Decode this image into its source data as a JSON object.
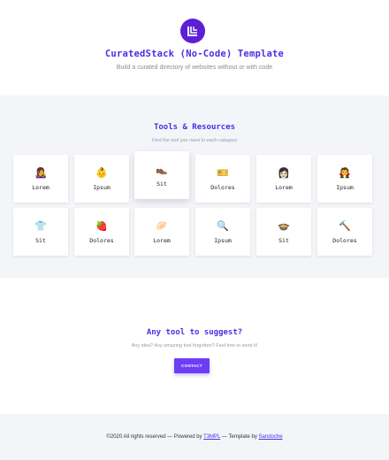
{
  "hero": {
    "title": "CuratedStack (No-Code) Template",
    "subtitle": "Build a curated directory of websites without or with code"
  },
  "tools": {
    "title": "Tools & Resources",
    "subtitle": "Find the tool you need in each category",
    "cards": [
      {
        "emoji": "👩‍🎤",
        "label": "Lorem"
      },
      {
        "emoji": "👶",
        "label": "Ipsum"
      },
      {
        "emoji": "👞",
        "label": "Sit"
      },
      {
        "emoji": "🎫",
        "label": "Dolores"
      },
      {
        "emoji": "👩🏻",
        "label": "Lorem"
      },
      {
        "emoji": "🧛",
        "label": "Ipsum"
      },
      {
        "emoji": "👕",
        "label": "Sit"
      },
      {
        "emoji": "🍓",
        "label": "Dolores"
      },
      {
        "emoji": "🥟",
        "label": "Lorem"
      },
      {
        "emoji": "🔍",
        "label": "Ipsum"
      },
      {
        "emoji": "🍲",
        "label": "Sit"
      },
      {
        "emoji": "🔨",
        "label": "Dolores"
      }
    ]
  },
  "suggest": {
    "title": "Any tool to suggest?",
    "subtitle": "Any idea? Any amazing tool forgotten? Feel free to send it!",
    "button_label": "CONTACT"
  },
  "footer": {
    "prefix": "©2020 All rights reserved — Powered by ",
    "link1": "T3MPL",
    "middle": " — Template by ",
    "link2": "Sandoche"
  },
  "colors": {
    "accent": "#4a2ee8",
    "button": "#6d3cf5",
    "logo": "#5b1fd6"
  }
}
